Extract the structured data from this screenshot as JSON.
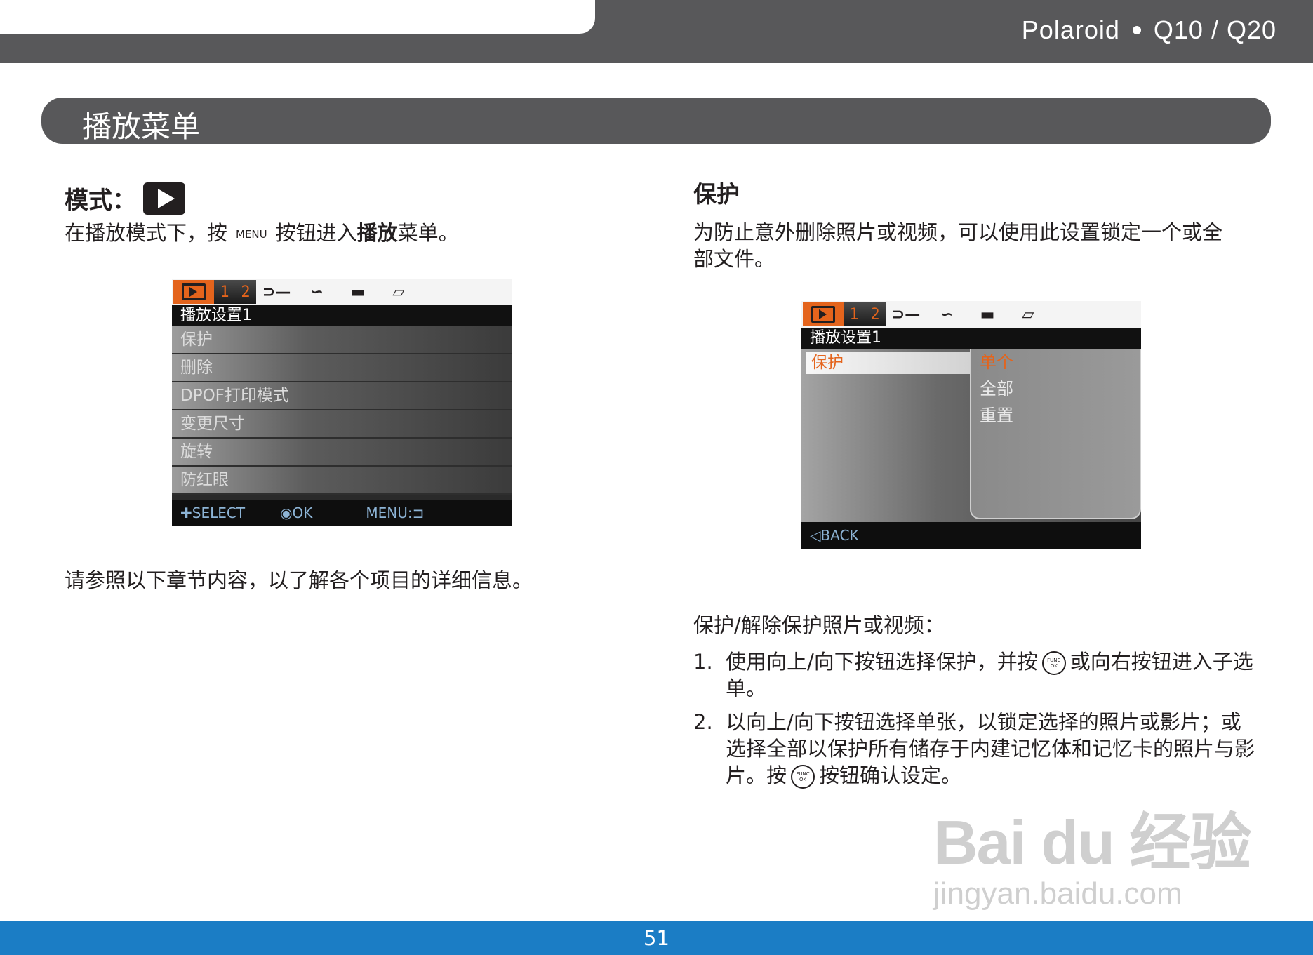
{
  "header": {
    "brand": "Polaroid",
    "model": "Q10 / Q20"
  },
  "section": {
    "title": "播放菜单"
  },
  "left": {
    "mode_label": "模式：",
    "intro_before": "在播放模式下，按",
    "menu_key": "MENU",
    "intro_mid": "按钮进入",
    "intro_bold": "播放",
    "intro_after": "菜单。",
    "refer_note": "请参照以下章节内容，以了解各个项目的详细信息。",
    "lcd": {
      "tab_numbers": [
        "1",
        "2"
      ],
      "title": "播放设置1",
      "items": [
        "保护",
        "删除",
        "DPOF打印模式",
        "变更尺寸",
        "旋转",
        "防红眼"
      ],
      "footer": {
        "select": "SELECT",
        "ok": "OK",
        "menu": "MENU:"
      }
    }
  },
  "right": {
    "heading": "保护",
    "intro": "为防止意外删除照片或视频，可以使用此设置锁定一个或全部文件。",
    "lcd": {
      "tab_numbers": [
        "1",
        "2"
      ],
      "title": "播放设置1",
      "selected": "保护",
      "sub_items": [
        "单个",
        "全部",
        "重置"
      ],
      "footer_back": "BACK"
    },
    "steps_title": "保护/解除保护照片或视频：",
    "steps": [
      {
        "num": "1.",
        "before": "使用向上/向下按钮选择保护，并按",
        "after": "或向右按钮进入子选单。"
      },
      {
        "num": "2.",
        "before": "以向上/向下按钮选择单张，以锁定选择的照片或影片；或选择全部以保护所有储存于内建记忆体和记忆卡的照片与影片。按",
        "after": "按钮确认设定。"
      }
    ],
    "func_ok_label": "FUNC OK"
  },
  "watermark": {
    "line1": "Bai du 经验",
    "line2": "jingyan.baidu.com"
  },
  "footer": {
    "page_number": "51"
  }
}
